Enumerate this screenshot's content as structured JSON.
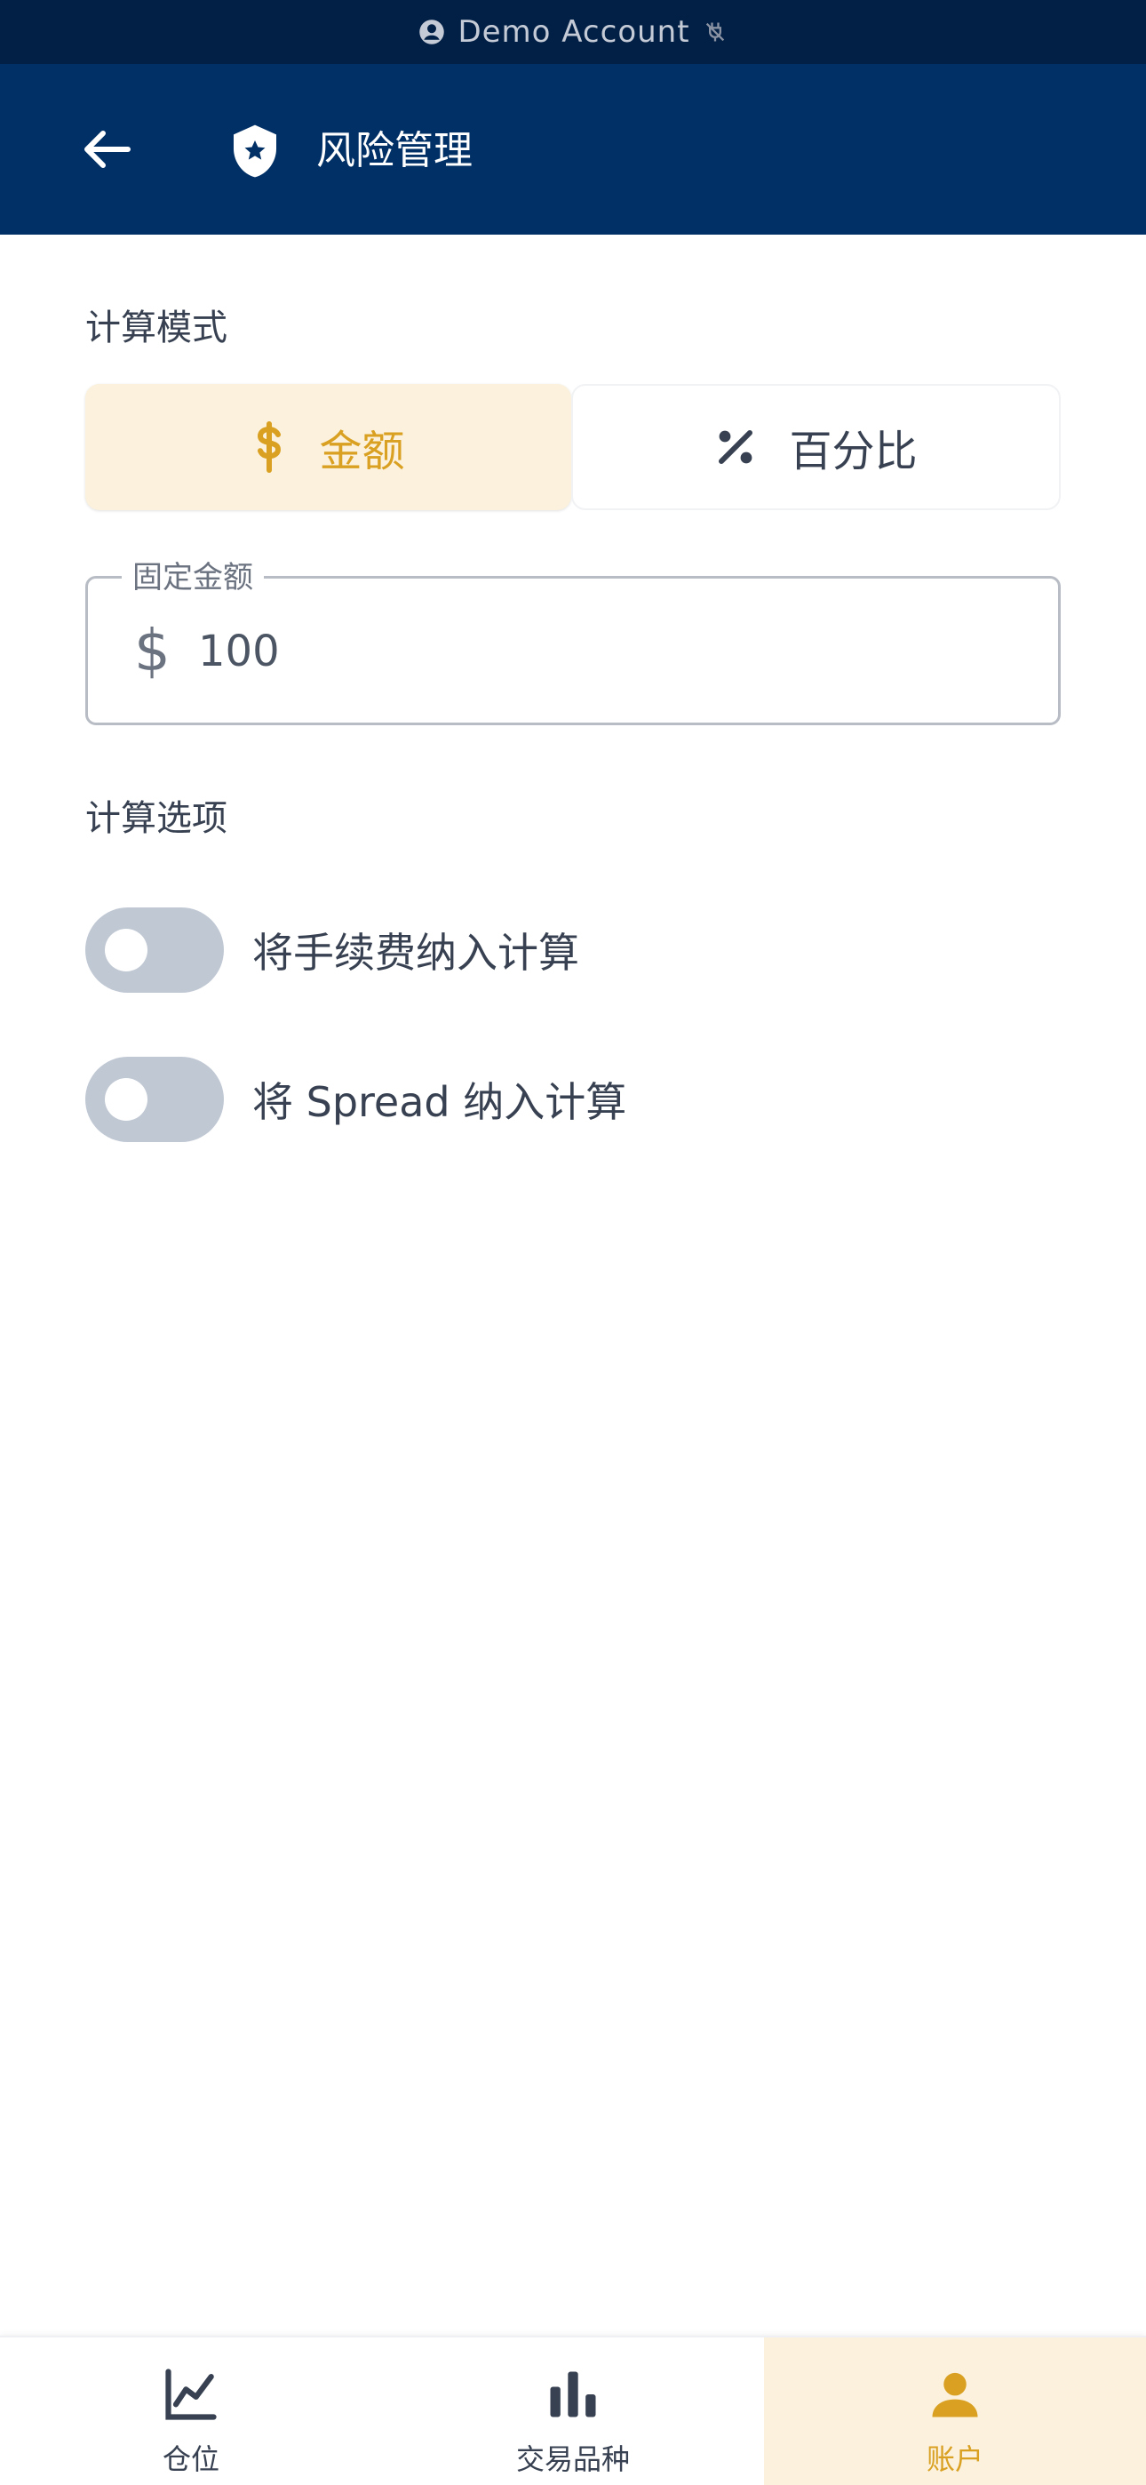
{
  "status_bar": {
    "account_label": "Demo Account"
  },
  "header": {
    "title": "风险管理"
  },
  "calc_mode": {
    "label": "计算模式",
    "options": [
      {
        "label": "金额",
        "icon": "dollar-icon",
        "active": true
      },
      {
        "label": "百分比",
        "icon": "percent-icon",
        "active": false
      }
    ]
  },
  "amount_field": {
    "label": "固定金额",
    "currency_symbol": "$",
    "value": "100"
  },
  "calc_options": {
    "label": "计算选项",
    "toggles": [
      {
        "label": "将手续费纳入计算",
        "on": false
      },
      {
        "label": "将 Spread 纳入计算",
        "on": false
      }
    ]
  },
  "bottom_nav": {
    "items": [
      {
        "label": "仓位",
        "icon": "line-chart-icon",
        "active": false
      },
      {
        "label": "交易品种",
        "icon": "bar-chart-icon",
        "active": false
      },
      {
        "label": "账户",
        "icon": "person-icon",
        "active": true
      }
    ]
  },
  "colors": {
    "status_bar_bg": "#021f45",
    "header_bg": "#003066",
    "accent": "#d9a021",
    "accent_bg": "#fbf1dc",
    "toggle_off": "#c0c8d4"
  }
}
